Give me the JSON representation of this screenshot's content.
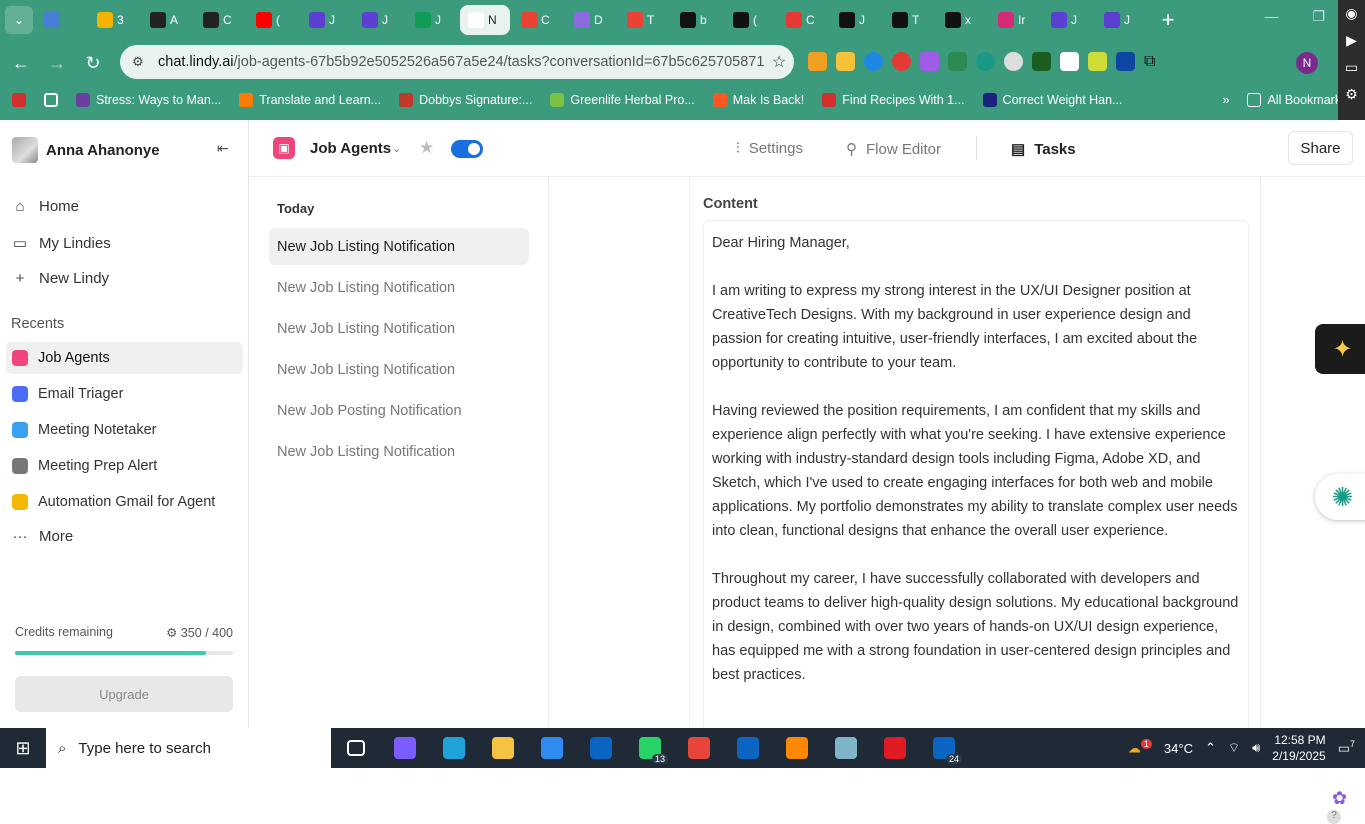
{
  "browser": {
    "tabs": [
      {
        "label": "",
        "color": "#4a7fd6"
      },
      {
        "label": "3",
        "color": "#f2b400"
      },
      {
        "label": "A",
        "color": "#222222"
      },
      {
        "label": "C",
        "color": "#222222"
      },
      {
        "label": "(",
        "color": "#ff0000"
      },
      {
        "label": "J",
        "color": "#5b3fd1"
      },
      {
        "label": "J",
        "color": "#5b3fd1"
      },
      {
        "label": "J",
        "color": "#0f9d58"
      },
      {
        "label": "N",
        "color": "#ffffff"
      },
      {
        "label": "C",
        "color": "#ea4335"
      },
      {
        "label": "D",
        "color": "#8a6be0"
      },
      {
        "label": "T",
        "color": "#ea4335"
      },
      {
        "label": "b",
        "color": "#111111"
      },
      {
        "label": "(",
        "color": "#111111"
      },
      {
        "label": "C",
        "color": "#e53935"
      },
      {
        "label": "J",
        "color": "#111111"
      },
      {
        "label": "T",
        "color": "#111111"
      },
      {
        "label": "x",
        "color": "#111111"
      },
      {
        "label": "Ir",
        "color": "#d62976"
      },
      {
        "label": "J",
        "color": "#5b3fd1"
      },
      {
        "label": "J",
        "color": "#5b3fd1"
      }
    ],
    "url_domain": "chat.lindy.ai",
    "url_path": "/job-agents-67b5b92e5052526a567a5e24/tasks?conversationId=67b5c625705871...",
    "profile_initial": "N",
    "bookmarks": [
      {
        "label": "Stress: Ways to Man...",
        "color": "#6b3fa0"
      },
      {
        "label": "Translate and Learn...",
        "color": "#ff7a00"
      },
      {
        "label": "Dobbys Signature:...",
        "color": "#c0392b"
      },
      {
        "label": "Greenlife Herbal Pro...",
        "color": "#7cc142"
      },
      {
        "label": "Mak Is Back!",
        "color": "#ff5722"
      },
      {
        "label": "Find Recipes With 1...",
        "color": "#d32f2f"
      },
      {
        "label": "Correct Weight Han...",
        "color": "#1a237e"
      }
    ],
    "all_bookmarks": "All Bookmarks"
  },
  "sidebar": {
    "user_name": "Anna Ahanonye",
    "nav": [
      {
        "label": "Home",
        "icon": "home-icon"
      },
      {
        "label": "My Lindies",
        "icon": "folder-icon"
      },
      {
        "label": "New Lindy",
        "icon": "plus-icon"
      }
    ],
    "recents_title": "Recents",
    "recents": [
      {
        "label": "Job Agents",
        "color": "#f0457c"
      },
      {
        "label": "Email Triager",
        "color": "#4a6cf7"
      },
      {
        "label": "Meeting Notetaker",
        "color": "#3aa0f0"
      },
      {
        "label": "Meeting Prep Alert",
        "color": "#777777"
      },
      {
        "label": "Automation Gmail for Agent",
        "color": "#f5b800"
      }
    ],
    "more_label": "More",
    "credits_label": "Credits remaining",
    "credits_value": "350 / 400",
    "credits_fraction": 0.875,
    "upgrade_label": "Upgrade"
  },
  "header": {
    "agent_name": "Job Agents",
    "tabs": [
      {
        "label": "Settings",
        "icon": "sliders-icon"
      },
      {
        "label": "Flow Editor",
        "icon": "flow-icon"
      },
      {
        "label": "Tasks",
        "icon": "clipboard-icon"
      }
    ],
    "share_label": "Share"
  },
  "tasks": {
    "group_title": "Today",
    "items": [
      "New Job Listing Notification",
      "New Job Listing Notification",
      "New Job Listing Notification",
      "New Job Listing Notification",
      "New Job Posting Notification",
      "New Job Listing Notification"
    ]
  },
  "detail": {
    "content_label": "Content",
    "paragraphs": [
      "Dear Hiring Manager,",
      "I am writing to express my strong interest in the UX/UI Designer position at CreativeTech Designs. With my background in user experience design and passion for creating intuitive, user-friendly interfaces, I am excited about the opportunity to contribute to your team.",
      "Having reviewed the position requirements, I am confident that my skills and experience align perfectly with what you're seeking. I have extensive experience working with industry-standard design tools including Figma, Adobe XD, and Sketch, which I've used to create engaging interfaces for both web and mobile applications. My portfolio demonstrates my ability to translate complex user needs into clean, functional designs that enhance the overall user experience.",
      "Throughout my career, I have successfully collaborated with developers and product teams to deliver high-quality design solutions. My educational background in design, combined with over two years of hands-on UX/UI design experience, has equipped me with a strong foundation in user-centered design principles and best practices."
    ]
  },
  "taskbar": {
    "search_placeholder": "Type here to search",
    "apps": [
      {
        "name": "task-view",
        "color": "#ffffff",
        "badge": ""
      },
      {
        "name": "copilot",
        "color": "#7b5cff",
        "badge": ""
      },
      {
        "name": "edge",
        "color": "#1fa3d8",
        "badge": ""
      },
      {
        "name": "file-explorer",
        "color": "#f6c244",
        "badge": ""
      },
      {
        "name": "store",
        "color": "#2f8cf0",
        "badge": ""
      },
      {
        "name": "outlook",
        "color": "#0a64c2",
        "badge": ""
      },
      {
        "name": "whatsapp",
        "color": "#25d366",
        "badge": "13"
      },
      {
        "name": "chrome",
        "color": "#e8453c",
        "badge": ""
      },
      {
        "name": "linkedin",
        "color": "#0a66c2",
        "badge": ""
      },
      {
        "name": "vlc",
        "color": "#ff8800",
        "badge": ""
      },
      {
        "name": "app",
        "color": "#7fb3c8",
        "badge": ""
      },
      {
        "name": "opera",
        "color": "#e01b24",
        "badge": ""
      },
      {
        "name": "linkedin-2",
        "color": "#0a66c2",
        "badge": "24"
      }
    ],
    "weather_badge": "1",
    "temperature": "34°C",
    "time": "12:58 PM",
    "date": "2/19/2025",
    "notifications": "7"
  }
}
